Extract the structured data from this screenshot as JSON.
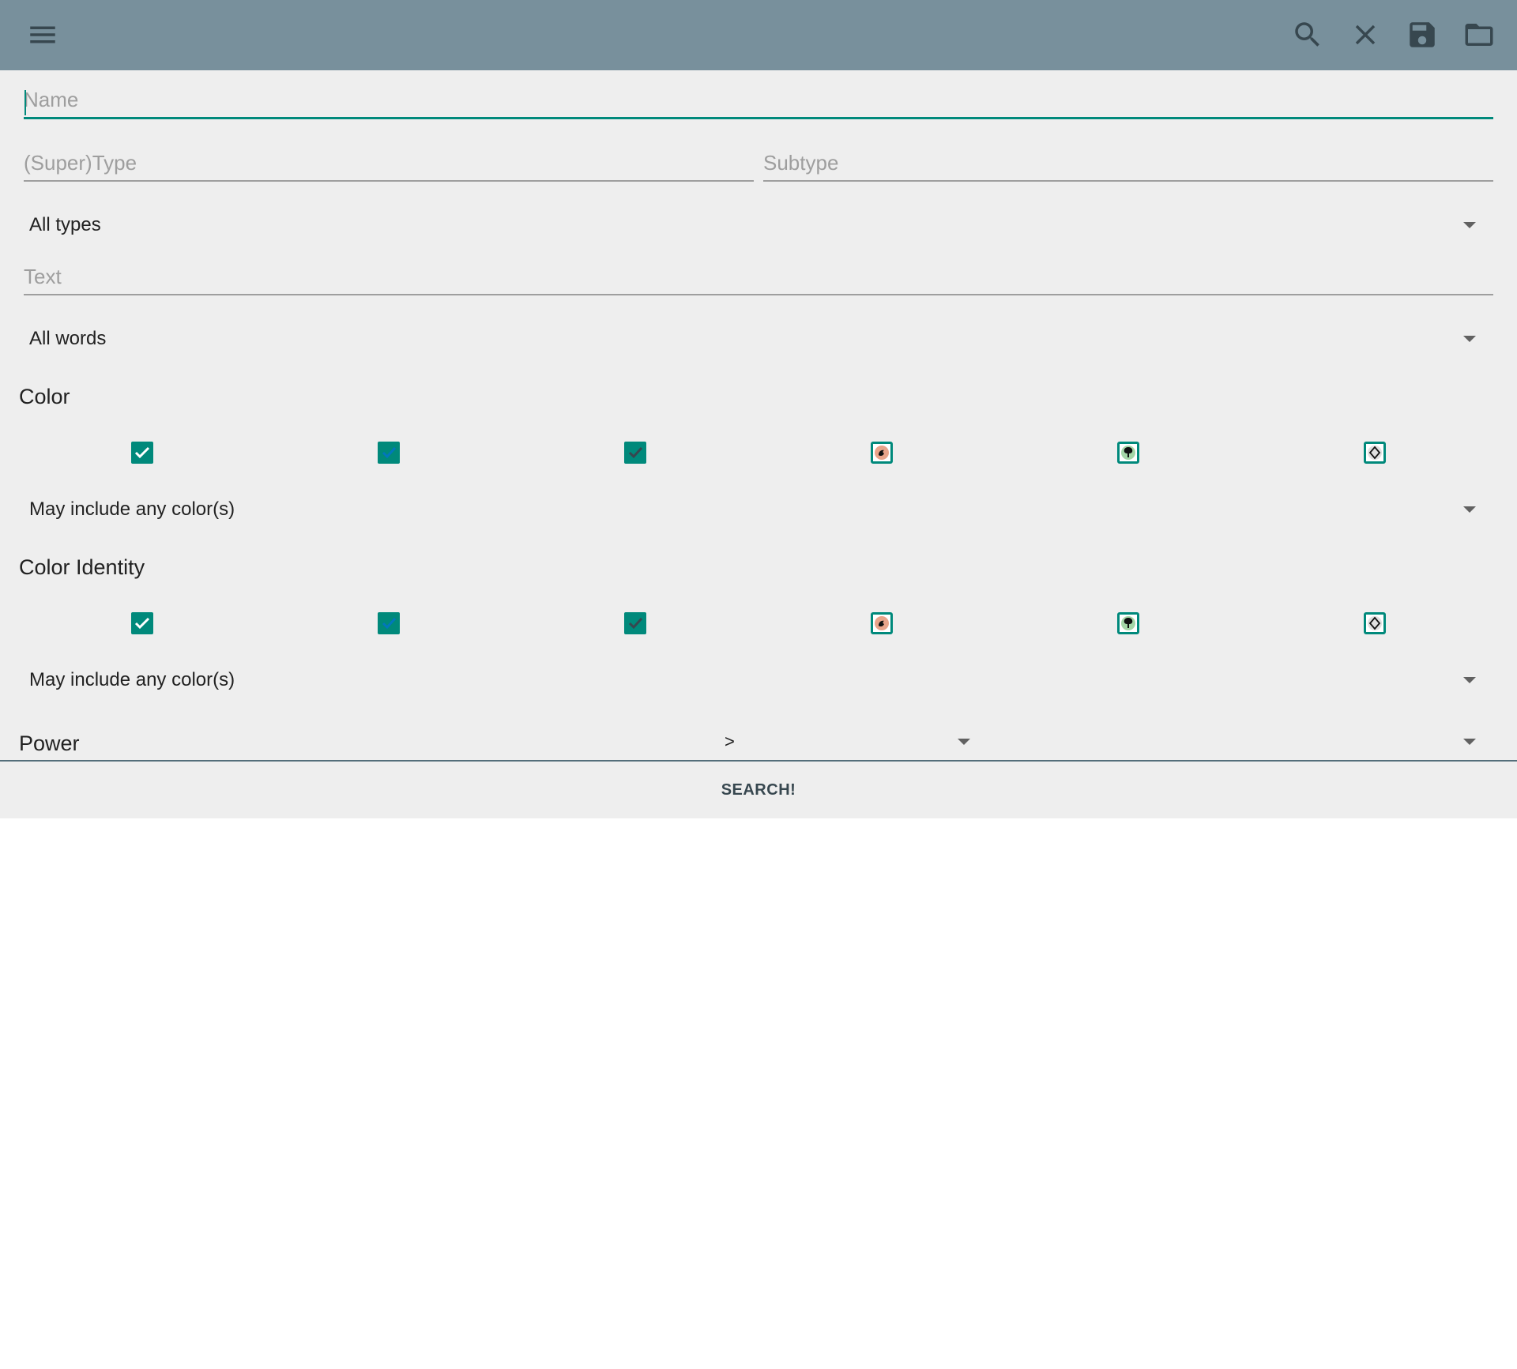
{
  "appbar": {
    "background": "#78909c",
    "icons": [
      "menu-icon",
      "search-icon",
      "close-icon",
      "save-icon",
      "folder-icon"
    ]
  },
  "form": {
    "name_placeholder": "Name",
    "name_value": "",
    "supertype_placeholder": "(Super)Type",
    "subtype_placeholder": "Subtype",
    "type_spinner": "All types",
    "text_placeholder": "Text",
    "words_spinner": "All words",
    "color": {
      "title": "Color",
      "spinner": "May include any color(s)"
    },
    "color_identity": {
      "title": "Color Identity",
      "spinner": "May include any color(s)"
    },
    "power": {
      "label": "Power",
      "comparator": ">",
      "value": ""
    }
  },
  "search_button": "SEARCH!",
  "colors": {
    "accent": "#00897b",
    "toolbar_icon": "#37474f"
  }
}
